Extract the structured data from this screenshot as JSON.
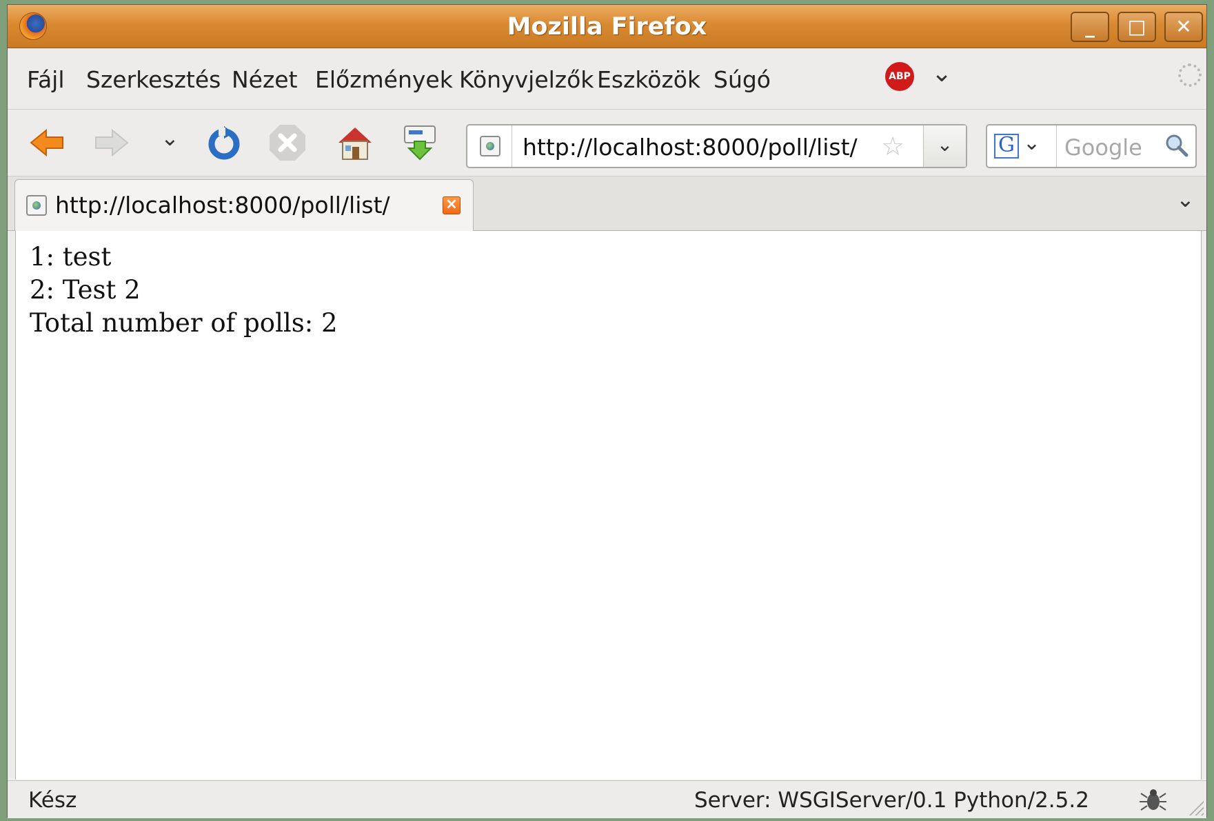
{
  "window": {
    "title": "Mozilla Firefox",
    "controls": {
      "minimize": "_",
      "maximize": "□",
      "close": "✕"
    }
  },
  "menubar": {
    "items": [
      {
        "label": "Fájl"
      },
      {
        "label": "Szerkesztés"
      },
      {
        "label": "Nézet"
      },
      {
        "label": "Előzmények"
      },
      {
        "label": "Könyvjelzők"
      },
      {
        "label": "Eszközök"
      },
      {
        "label": "Súgó"
      }
    ],
    "adblock_icon": "abp-icon",
    "adblock_label": "ABP"
  },
  "navbar": {
    "icons": [
      "back-icon",
      "forward-icon",
      "reload-icon",
      "stop-icon",
      "home-icon",
      "bookmark-download-icon"
    ],
    "url": "http://localhost:8000/poll/list/",
    "search_placeholder": "Google",
    "search_engine_letter": "G"
  },
  "tabs": [
    {
      "label": "http://localhost:8000/poll/list/",
      "active": true
    }
  ],
  "content": {
    "lines": [
      "1: test",
      "2: Test 2",
      "Total number of polls: 2"
    ]
  },
  "statusbar": {
    "status": "Kész",
    "server": "Server: WSGIServer/0.1 Python/2.5.2"
  },
  "colors": {
    "titlebar": "#d98a31",
    "accent_orange": "#f06a12",
    "reload_blue": "#2a6fc4"
  }
}
